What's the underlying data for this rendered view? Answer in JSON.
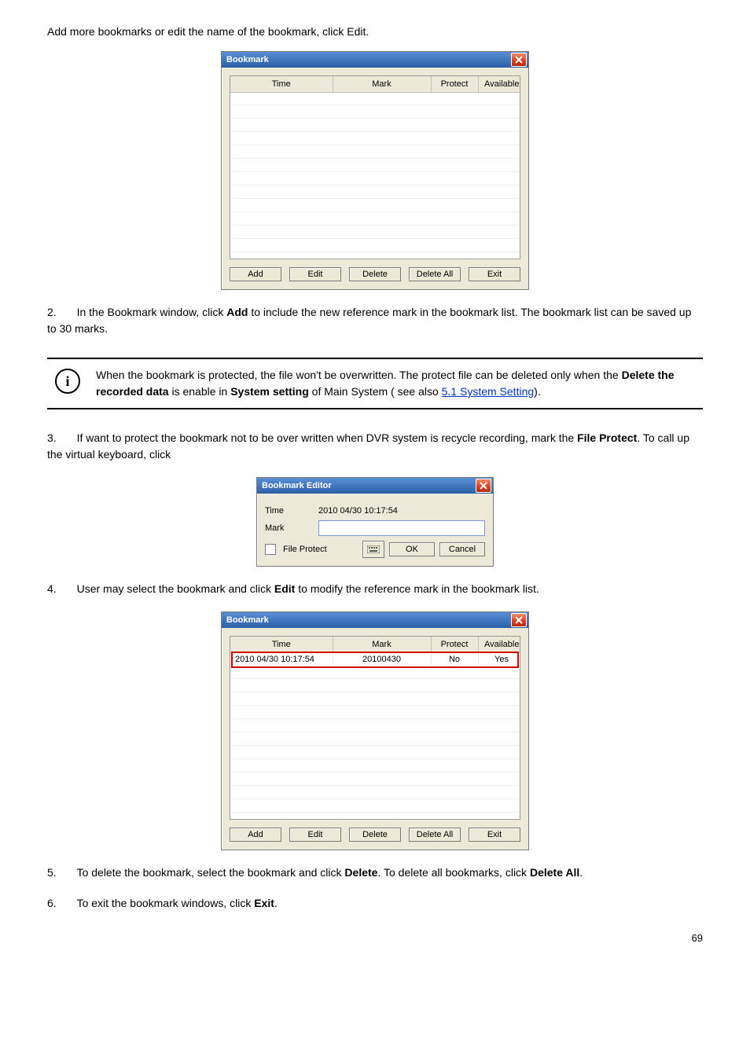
{
  "intro": "Add more bookmarks or edit the name of the bookmark, click Edit.",
  "steps": [
    {
      "n": "2.",
      "text_a": "In the Bookmark window, click ",
      "bold": "Add",
      "text_b": " to include the new reference mark in the bookmark list. The bookmark list can be saved up to 30 marks."
    },
    {
      "n": "3.",
      "text_a": "If want to protect the bookmark not to be over written when DVR system is recycle recording, mark the ",
      "bold": "File Protect",
      "text_b": ". To call up the virtual keyboard, click "
    },
    {
      "n": "4.",
      "text_a": "User may select the bookmark and click ",
      "bold": "Edit",
      "text_b": " to modify the reference mark in the bookmark list."
    },
    {
      "n": "5.",
      "text_a": "To delete the bookmark, select the bookmark and click ",
      "bold": "Delete",
      "text_b": ". To delete all bookmarks, click ",
      "bold2": "Delete All",
      "text_c": "."
    },
    {
      "n": "6.",
      "text_a": "To exit the bookmark windows, click ",
      "bold": "Exit",
      "text_b": "."
    }
  ],
  "bookmark_dialog": {
    "title": "Bookmark",
    "cols": {
      "time": "Time",
      "mark": "Mark",
      "protect": "Protect",
      "available": "Available"
    },
    "buttons": {
      "add": "Add",
      "edit": "Edit",
      "delete": "Delete",
      "delete_all": "Delete All",
      "exit": "Exit"
    }
  },
  "bookmark_editor": {
    "title": "Bookmark Editor",
    "time_label": "Time",
    "time_value": "2010 04/30 10:17:54",
    "mark_label": "Mark",
    "file_protect": "File Protect",
    "ok": "OK",
    "cancel": "Cancel"
  },
  "bookmark_list_row": {
    "time": "2010 04/30 10:17:54",
    "mark": "20100430",
    "protect": "No",
    "available": "Yes"
  },
  "info": {
    "line1_a": "When the bookmark is protected, the file won't be overwritten. The protect file can be deleted only when the ",
    "line1_bold": "Delete the recorded data",
    "line1_b": " is enable in ",
    "line1_bold2": "System setting",
    "line1_c": " of Main System ( see also ",
    "link": "5.1 System Setting",
    "line1_d": ")."
  },
  "page_num": "69"
}
